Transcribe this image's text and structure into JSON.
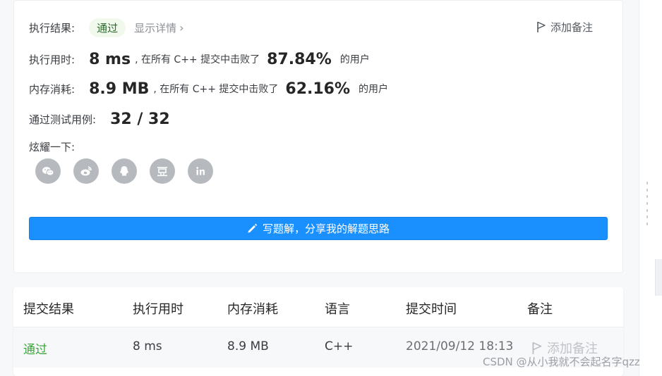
{
  "result": {
    "label": "执行结果:",
    "badge": "通过",
    "details_link": "显示详情",
    "note_button": "添加备注"
  },
  "runtime": {
    "label": "执行用时:",
    "value": "8 ms",
    "prefix": ", 在所有 C++ 提交中击败了",
    "percent": "87.84%",
    "suffix": "的用户"
  },
  "memory": {
    "label": "内存消耗:",
    "value": "8.9 MB",
    "prefix": ", 在所有 C++ 提交中击败了",
    "percent": "62.16%",
    "suffix": "的用户"
  },
  "tests": {
    "label": "通过测试用例:",
    "value": "32 / 32"
  },
  "share": {
    "label": "炫耀一下:",
    "icons": [
      "wechat-icon",
      "weibo-icon",
      "qq-icon",
      "douban-icon",
      "linkedin-icon"
    ]
  },
  "write_button": "写题解，分享我的解题思路",
  "table": {
    "headers": [
      "提交结果",
      "执行用时",
      "内存消耗",
      "语言",
      "提交时间",
      "备注"
    ],
    "rows": [
      {
        "result": "通过",
        "runtime": "8 ms",
        "memory": "8.9 MB",
        "language": "C++",
        "time": "2021/09/12 18:13",
        "note": "添加备注"
      }
    ]
  },
  "watermark": "CSDN @从小我就不会起名字qzz",
  "colors": {
    "accent": "#1a90ff",
    "pass": "#3aa63a",
    "badge_bg": "#f0f9eb",
    "icon_gray": "#b6babf"
  }
}
